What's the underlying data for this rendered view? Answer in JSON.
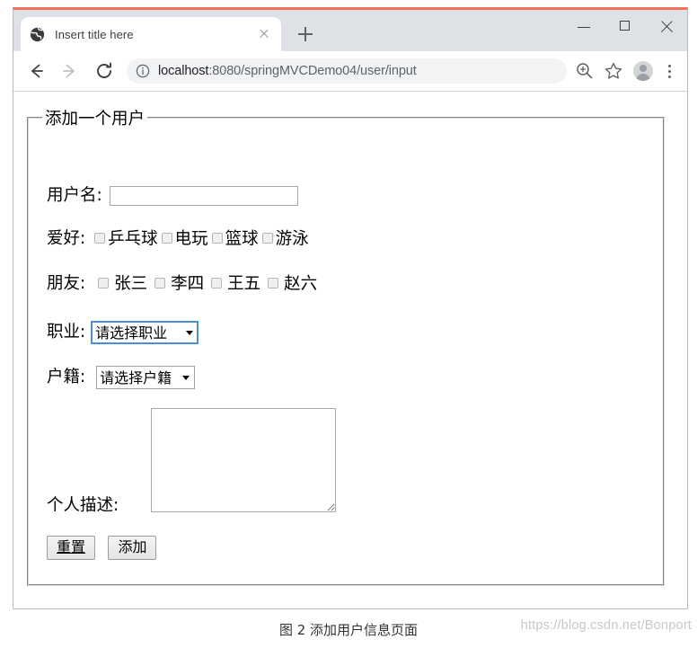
{
  "browser": {
    "tab": {
      "title": "Insert title here",
      "favicon": "globe-icon",
      "close_label": "×"
    },
    "newtab_label": "+",
    "window_controls": {
      "minimize": "−",
      "maximize": "□",
      "close": "×"
    },
    "toolbar": {
      "back": "back-arrow-icon",
      "forward": "forward-arrow-icon",
      "reload": "reload-icon",
      "site_info": "info-circle-icon",
      "url_host": "localhost",
      "url_rest": ":8080/springMVCDemo04/user/input",
      "url_full": "localhost:8080/springMVCDemo04/user/input",
      "zoom": "zoom-in-icon",
      "bookmark": "star-icon",
      "profile": "avatar-icon",
      "menu": "kebab-menu-icon"
    }
  },
  "page": {
    "legend": "添加一个用户",
    "username": {
      "label": "用户名:",
      "value": "",
      "placeholder": ""
    },
    "hobby": {
      "label": "爱好:",
      "options": [
        "乒乓球",
        "电玩",
        "篮球",
        "游泳"
      ]
    },
    "friend": {
      "label": "朋友:",
      "options": [
        "张三",
        "李四",
        "王五",
        "赵六"
      ]
    },
    "job": {
      "label": "职业:",
      "selected": "请选择职业",
      "focused": true,
      "options": [
        "请选择职业"
      ]
    },
    "origin": {
      "label": "户籍:",
      "selected": "请选择户籍",
      "focused": false,
      "options": [
        "请选择户籍"
      ]
    },
    "description": {
      "label": "个人描述:",
      "value": ""
    },
    "buttons": {
      "reset": "重置",
      "submit": "添加"
    }
  },
  "caption": {
    "text": "图 2  添加用户信息页面",
    "watermark": "https://blog.csdn.net/Bonport"
  },
  "colors": {
    "accent_top": "#f4705a",
    "chrome_bg": "#dee1e6",
    "focus_blue": "#4a90d9",
    "omnibox_bg": "#f1f3f4"
  }
}
